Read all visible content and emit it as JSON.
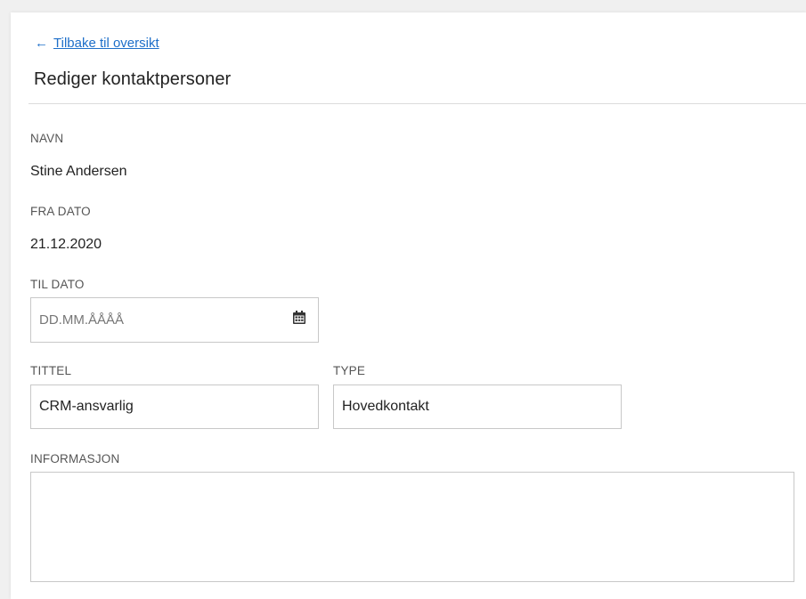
{
  "nav": {
    "back_arrow": "←",
    "back_label": "Tilbake til oversikt"
  },
  "page": {
    "title": "Rediger kontaktpersoner"
  },
  "fields": {
    "navn": {
      "label": "NAVN",
      "value": "Stine Andersen"
    },
    "fra_dato": {
      "label": "FRA DATO",
      "value": "21.12.2020"
    },
    "til_dato": {
      "label": "TIL DATO",
      "value": "",
      "placeholder": "DD.MM.ÅÅÅÅ",
      "icon": "calendar-icon"
    },
    "tittel": {
      "label": "TITTEL",
      "value": "CRM-ansvarlig"
    },
    "type": {
      "label": "TYPE",
      "value": "Hovedkontakt"
    },
    "informasjon": {
      "label": "INFORMASJON",
      "value": ""
    }
  },
  "colors": {
    "link": "#1e6fc9",
    "border": "#c8c8c8",
    "label": "#555555"
  }
}
